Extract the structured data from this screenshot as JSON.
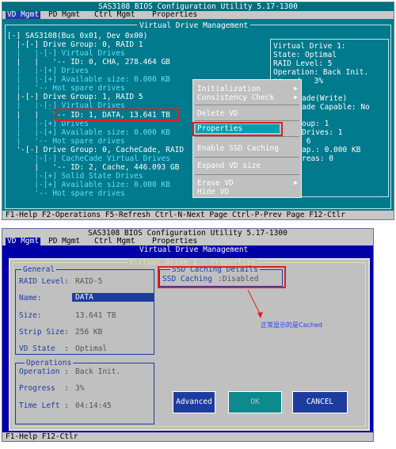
{
  "panel1": {
    "title": "SAS3108 BIOS Configuration Utility 5.17-1300",
    "tabs": [
      "VD Mgmt",
      "PD Mgmt",
      "Ctrl Mgmt",
      "Properties"
    ],
    "section_title": "Virtual Drive Management",
    "tree": [
      "[-] SAS3108(Bus 0x01, Dev 0x00)",
      "  |-[-] Drive Group: 0, RAID 1",
      "  |   |-[-] Virtual Drives",
      "  |   |   '-- ID: 0, CHA, 278.464 GB",
      "  |   |-[+] Drives",
      "  |   |-[+] Available size: 0.000 KB",
      "  |   '-- Hot spare drives",
      "  |-[-] Drive Group: 1, RAID 5",
      "  |   |-[-] Virtual Drives",
      "  |   |   '-- ID: 1, DATA, 13.641 TB",
      "  |   |-[+] Drives",
      "  |   |-[+] Available size: 0.000 KB",
      "  |   '-- Hot spare drives",
      "  '-[-] Drive Group: 0, CacheCade, RAID",
      "      |-[-] CacheCade Virtual Drives",
      "      |   '-- ID: 2, Cache, 446.093 GB",
      "      |-[+] Solid State Drives",
      "      |-[+] Available size: 0.000 KB",
      "      '-- Hot spare drives"
    ],
    "right_info": [
      "Virtual Drive 1:",
      "State: Optimal",
      "RAID Level: 5",
      "Operation: Back Init.",
      "ss:  /   3%",
      "",
      "ade(Write)",
      "ade Capable: No",
      "",
      "oup: 1",
      "Drives: 1",
      " 6",
      "ap.: 0.000 KB",
      "reas: 0"
    ],
    "menu": [
      "Initialization",
      "Consistency Check",
      "Delete VD",
      "Properties",
      "Enable SSD Caching",
      "Expand VD size",
      "Erase VD",
      "Hide VD"
    ],
    "status": "F1-Help F2-Operations F5-Refresh Ctrl-N-Next Page Ctrl-P-Prev Page F12-Ctlr"
  },
  "panel2": {
    "title": "SAS3108 BIOS Configuration Utility 5.17-1300",
    "tabs": [
      "VD Mgmt",
      "PD Mgmt",
      "Ctrl Mgmt",
      "Properties"
    ],
    "dialog_title": "Virtual Drive 1 - Properties",
    "general": {
      "legend": "General",
      "raid_label": "RAID Level:",
      "raid_value": "RAID-5",
      "name_label": "Name:",
      "name_value": "DATA",
      "size_label": "Size:",
      "size_value": "13.641 TB",
      "strip_label": "Strip Size:",
      "strip_value": "256 KB",
      "state_label": "VD State  :",
      "state_value": "Optimal"
    },
    "ssd": {
      "legend": "SSD Caching Details",
      "label": "SSD Caching",
      "value": ":Disabled"
    },
    "operations": {
      "legend": "Operations",
      "op_label": "Operation :",
      "op_value": "Back Init.",
      "progress_label": "Progress  :",
      "progress_value": "3%",
      "time_label": "Time Left :",
      "time_value": "04:14:45"
    },
    "buttons": {
      "advanced": "Advanced",
      "ok": "OK",
      "cancel": "CANCEL"
    },
    "annotation": "正常显示的是Cached",
    "status": "F1-Help F12-Ctlr"
  }
}
